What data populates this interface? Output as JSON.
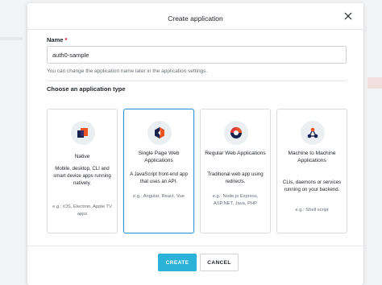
{
  "modal": {
    "title": "Create application"
  },
  "name_field": {
    "label": "Name",
    "required_mark": "*",
    "value": "auth0-sample",
    "help": "You can change the application name later in the application settings."
  },
  "app_type": {
    "label": "Choose an application type",
    "selected": "Single Page Web Applications",
    "cards": [
      {
        "title": "Native",
        "desc": "Mobile, desktop, CLI and smart device apps running natively.",
        "examples": "e.g.: iOS, Electron, Apple TV apps",
        "icon": "native-icon"
      },
      {
        "title": "Single Page Web Applications",
        "desc": "A JavaScript front-end app that uses an API.",
        "examples": "e.g.: Angular, React, Vue",
        "icon": "spa-icon"
      },
      {
        "title": "Regular Web Applications",
        "desc": "Traditional web app using redirects.",
        "examples": "e.g.: Node.js Express, ASP.NET, Java, PHP",
        "icon": "regular-web-icon"
      },
      {
        "title": "Machine to Machine Applications",
        "desc": "CLIs, daemons or services running on your backend.",
        "examples": "e.g.: Shell script",
        "icon": "m2m-icon"
      }
    ]
  },
  "buttons": {
    "create": "CREATE",
    "cancel": "CANCEL"
  },
  "colors": {
    "accent": "#2cb1d9",
    "selected_border": "#2f95d6"
  }
}
